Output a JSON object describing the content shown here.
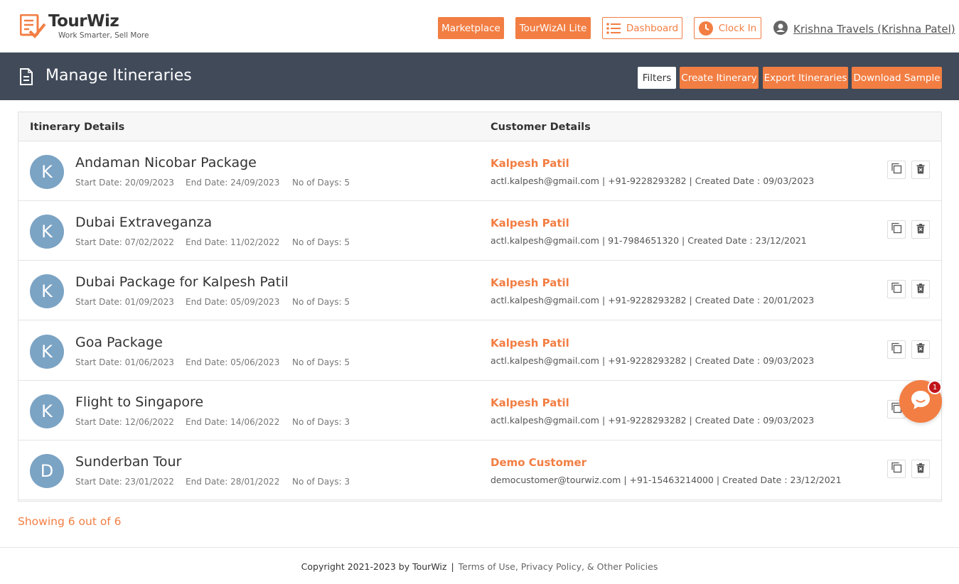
{
  "brand": {
    "name": "TourWiz",
    "tagline": "Work Smarter, Sell More",
    "accent": "#f27e43",
    "band": "#404a59"
  },
  "header": {
    "marketplace": "Marketplace",
    "lite": "TourWizAI Lite",
    "dashboard": "Dashboard",
    "clock_in": "Clock In",
    "user": "Krishna Travels (Krishna Patel)"
  },
  "page": {
    "title": "Manage Itineraries",
    "filters": "Filters",
    "create": "Create Itinerary",
    "export": "Export Itineraries",
    "sample": "Download Sample"
  },
  "table": {
    "col_itinerary": "Itinerary Details",
    "col_customer": "Customer Details",
    "rows": [
      {
        "initial": "K",
        "title": "Andaman Nicobar Package",
        "start": "Start Date: 20/09/2023",
        "end": "End Date: 24/09/2023",
        "days": "No of Days: 5",
        "customer": "Kalpesh Patil",
        "info": "actl.kalpesh@gmail.com | +91-9228293282 | Created Date : 09/03/2023"
      },
      {
        "initial": "K",
        "title": "Dubai Extraveganza",
        "start": "Start Date: 07/02/2022",
        "end": "End Date: 11/02/2022",
        "days": "No of Days: 5",
        "customer": "Kalpesh Patil",
        "info": "actl.kalpesh@gmail.com | 91-7984651320 | Created Date : 23/12/2021"
      },
      {
        "initial": "K",
        "title": "Dubai Package for Kalpesh Patil",
        "start": "Start Date: 01/09/2023",
        "end": "End Date: 05/09/2023",
        "days": "No of Days: 5",
        "customer": "Kalpesh Patil",
        "info": "actl.kalpesh@gmail.com | +91-9228293282 | Created Date : 20/01/2023"
      },
      {
        "initial": "K",
        "title": "Goa Package",
        "start": "Start Date: 01/06/2023",
        "end": "End Date: 05/06/2023",
        "days": "No of Days: 5",
        "customer": "Kalpesh Patil",
        "info": "actl.kalpesh@gmail.com | +91-9228293282 | Created Date : 09/03/2023"
      },
      {
        "initial": "K",
        "title": "Flight to Singapore",
        "start": "Start Date: 12/06/2022",
        "end": "End Date: 14/06/2022",
        "days": "No of Days: 3",
        "customer": "Kalpesh Patil",
        "info": "actl.kalpesh@gmail.com | +91-9228293282 | Created Date : 09/03/2023"
      },
      {
        "initial": "D",
        "title": "Sunderban Tour",
        "start": "Start Date: 23/01/2022",
        "end": "End Date: 28/01/2022",
        "days": "No of Days: 3",
        "customer": "Demo Customer",
        "info": "democustomer@tourwiz.com | +91-15463214000 | Created Date : 23/12/2021"
      }
    ]
  },
  "showing": "Showing 6 out of 6",
  "footer": {
    "copyright": "Copyright 2021-2023 by TourWiz",
    "sep": "|",
    "links": "Terms of Use, Privacy Policy, & Other Policies"
  },
  "chat": {
    "badge": "1"
  }
}
